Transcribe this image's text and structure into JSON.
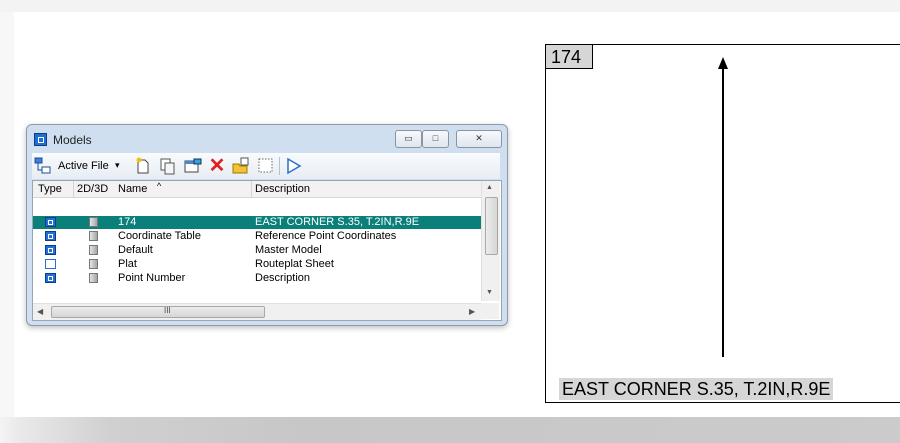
{
  "window": {
    "title": "Models",
    "controls": {
      "minimize": "▭",
      "maximize": "□",
      "close": "✕"
    }
  },
  "toolbar": {
    "active_file_label": "Active File",
    "dropdown_glyph": "▾"
  },
  "table": {
    "headers": {
      "type": "Type",
      "dim": "2D/3D",
      "name": "Name",
      "sort": "^",
      "description": "Description"
    },
    "rows": [
      {
        "type_icon": "model-icon",
        "name": "174",
        "description": "EAST CORNER S.35, T.2IN,R.9E",
        "selected": true
      },
      {
        "type_icon": "model-icon",
        "name": "Coordinate Table",
        "description": "Reference Point Coordinates",
        "selected": false
      },
      {
        "type_icon": "model-icon",
        "name": "Default",
        "description": "Master Model",
        "selected": false
      },
      {
        "type_icon": "sheet-icon",
        "name": "Plat",
        "description": "Routeplat Sheet",
        "selected": false
      },
      {
        "type_icon": "model-icon",
        "name": "Point Number",
        "description": "Description",
        "selected": false
      }
    ],
    "scroll_grip": "III"
  },
  "drawing": {
    "model_number": "174",
    "description": "EAST CORNER S.35, T.2IN,R.9E"
  },
  "colors": {
    "selection": "#0b7f7a",
    "model_icon": "#2070d8",
    "window_frame": "#cfdff0"
  }
}
